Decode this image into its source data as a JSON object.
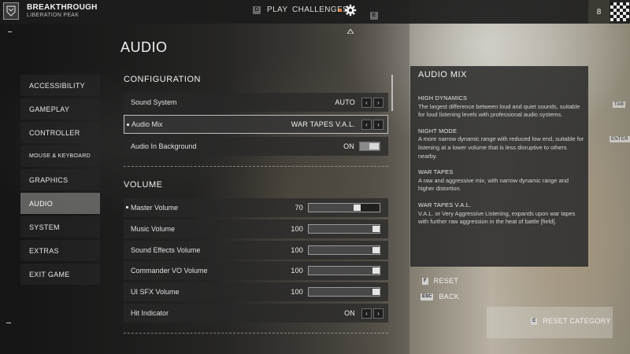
{
  "header": {
    "mode_title": "BREAKTHROUGH",
    "mode_subtitle": "LIBERATION PEAK",
    "nav_play_key": "D",
    "nav_play_label": "PLAY",
    "nav_challenges_label": "CHALLENGES",
    "nav_next_key": "E",
    "level": "8"
  },
  "page_title": "AUDIO",
  "sidebar": {
    "items": [
      {
        "label": "ACCESSIBILITY"
      },
      {
        "label": "GAMEPLAY"
      },
      {
        "label": "CONTROLLER"
      },
      {
        "label": "MOUSE & KEYBOARD"
      },
      {
        "label": "GRAPHICS"
      },
      {
        "label": "AUDIO",
        "active": true
      },
      {
        "label": "SYSTEM"
      },
      {
        "label": "EXTRAS"
      },
      {
        "label": "EXIT GAME"
      }
    ]
  },
  "configuration": {
    "title": "CONFIGURATION",
    "rows": [
      {
        "label": "Sound System",
        "value": "AUTO"
      },
      {
        "label": "Audio Mix",
        "value": "WAR TAPES V.A.L."
      },
      {
        "label": "Audio In Background",
        "value": "ON"
      }
    ]
  },
  "volume": {
    "title": "VOLUME",
    "rows": [
      {
        "label": "Master Volume",
        "value": "70",
        "level": 0.7
      },
      {
        "label": "Music Volume",
        "value": "100",
        "level": 1.0
      },
      {
        "label": "Sound Effects Volume",
        "value": "100",
        "level": 1.0
      },
      {
        "label": "Commander VO Volume",
        "value": "100",
        "level": 1.0
      },
      {
        "label": "UI SFX Volume",
        "value": "100",
        "level": 1.0
      },
      {
        "label": "Hit Indicator",
        "value": "ON"
      }
    ]
  },
  "info_panel": {
    "title": "AUDIO MIX",
    "blocks": [
      {
        "heading": "HIGH DYNAMICS",
        "text": "The largest difference between loud and quiet sounds, suitable for loud listening levels with professional audio systems."
      },
      {
        "heading": "NIGHT MODE",
        "text": "A more narrow dynamic range with reduced low end, suitable for listening at a lower volume that is less disruptive to others nearby."
      },
      {
        "heading": "WAR TAPES",
        "text": "A raw and aggressive mix, with narrow dynamic range and higher distortion."
      },
      {
        "heading": "WAR TAPES V.A.L.",
        "text": "V.A.L. or Very Aggressive Listening, expands upon war tapes with further raw aggression in the heat of battle [field]."
      }
    ]
  },
  "actions": {
    "reset_key": "F",
    "reset_label": "RESET",
    "back_key": "ESC",
    "back_label": "BACK",
    "reset_category_key": "C",
    "reset_category_label": "RESET CATEGORY"
  },
  "side_tabs": {
    "tab": "TAB",
    "enter": "ENTER"
  },
  "colors": {
    "accent_dot": "#e8782a",
    "active_item": "#6e6e6c"
  }
}
